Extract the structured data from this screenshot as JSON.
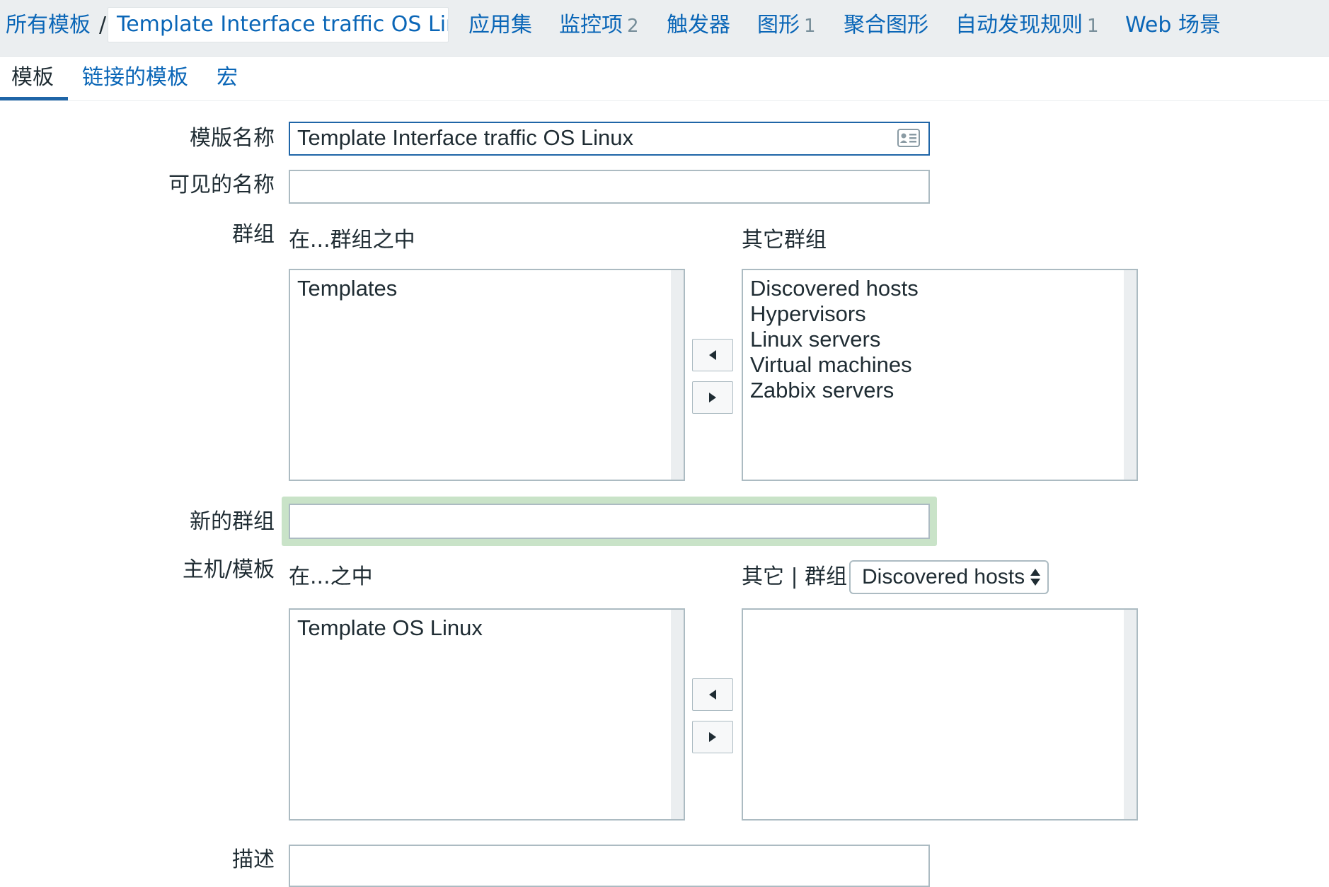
{
  "breadcrumb": {
    "root": "所有模板",
    "separator": "/",
    "current": "Template Interface traffic OS Linux"
  },
  "nav": {
    "applications": "应用集",
    "items": "监控项",
    "items_count": "2",
    "triggers": "触发器",
    "graphs": "图形",
    "graphs_count": "1",
    "screens": "聚合图形",
    "discovery": "自动发现规则",
    "discovery_count": "1",
    "web": "Web 场景"
  },
  "tabs": {
    "template": "模板",
    "linked": "链接的模板",
    "macros": "宏"
  },
  "form": {
    "template_name_label": "模版名称",
    "template_name_value": "Template Interface traffic OS Linux",
    "visible_name_label": "可见的名称",
    "visible_name_value": "",
    "groups_label": "群组",
    "in_groups_label": "在...群组之中",
    "other_groups_label": "其它群组",
    "in_groups": [
      "Templates"
    ],
    "other_groups": [
      "Discovered hosts",
      "Hypervisors",
      "Linux servers",
      "Virtual machines",
      "Zabbix servers"
    ],
    "new_group_label": "新的群组",
    "new_group_value": "",
    "hosts_label": "主机/模板",
    "in_hosts_label": "在...之中",
    "other_hosts_label": "其它 | 群组",
    "group_select_value": "Discovered hosts",
    "in_hosts": [
      "Template OS Linux"
    ],
    "other_hosts": [],
    "description_label": "描述"
  },
  "colors": {
    "link": "#0a66b7",
    "focus_border": "#1f65a7",
    "new_group_highlight": "#c9e3c8"
  },
  "icons": {
    "name_field": "contact-card-icon",
    "move_left": "triangle-left-icon",
    "move_right": "triangle-right-icon",
    "select": "up-down-caret-icon"
  }
}
